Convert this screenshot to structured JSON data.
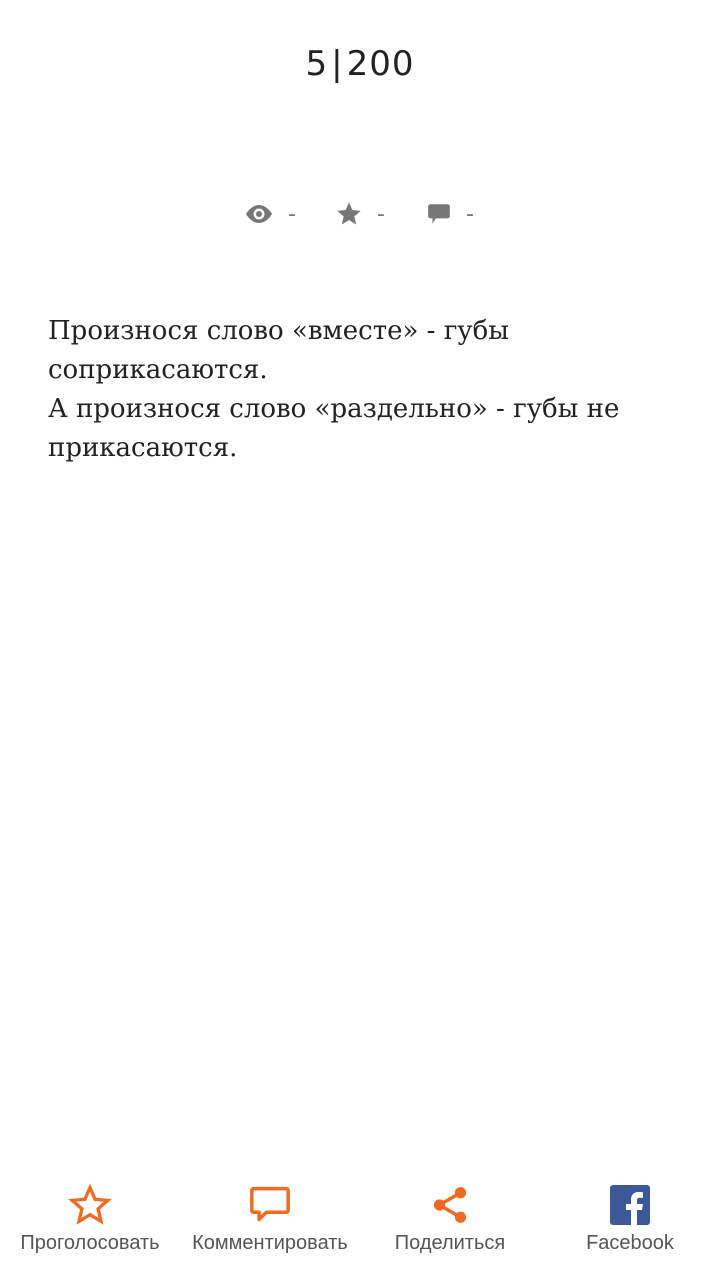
{
  "counter": {
    "current": "5",
    "separator": "|",
    "total": "200"
  },
  "stats": {
    "views": "-",
    "rating": "-",
    "comments": "-"
  },
  "quote": {
    "line1": "Произнося слово «вместе» - губы соприкасаются.",
    "line2": "А произнося слово «раздельно» - губы не прикасаются."
  },
  "actions": {
    "vote": "Проголосовать",
    "comment": "Комментировать",
    "share": "Поделиться",
    "facebook": "Facebook"
  },
  "colors": {
    "accent": "#f26a21",
    "facebook": "#3b5998",
    "stat_icon": "#777777"
  },
  "icons": {
    "views": "eye-icon",
    "rating": "star-icon",
    "comments": "speech-bubble-icon",
    "vote": "star-outline-icon",
    "comment": "comment-icon",
    "share": "share-icon",
    "facebook": "facebook-icon"
  }
}
